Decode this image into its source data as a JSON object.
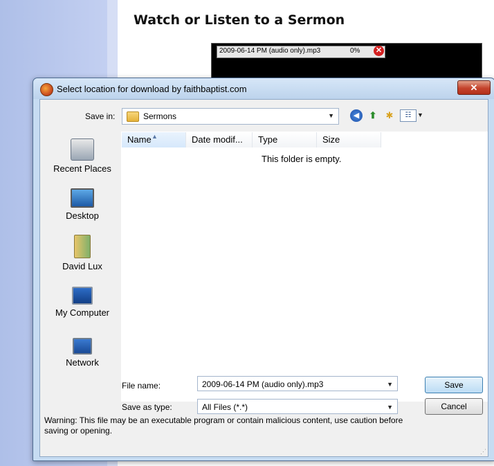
{
  "page": {
    "heading": "Watch or Listen to a Sermon"
  },
  "download_chip": {
    "filename": "2009-06-14 PM (audio only).mp3",
    "percent": "0%",
    "close_glyph": "✕"
  },
  "dialog": {
    "title": "Select location for download by faithbaptist.com",
    "close_glyph": "✕",
    "save_in_label": "Save in:",
    "save_in_value": "Sermons",
    "places": [
      {
        "label": "Recent Places",
        "icon": "recent-places-icon"
      },
      {
        "label": "Desktop",
        "icon": "desktop-icon"
      },
      {
        "label": "David Lux",
        "icon": "user-folder-icon"
      },
      {
        "label": "My Computer",
        "icon": "computer-icon"
      },
      {
        "label": "Network",
        "icon": "network-icon"
      }
    ],
    "columns": [
      "Name",
      "Date modif...",
      "Type",
      "Size"
    ],
    "empty_message": "This folder is empty.",
    "file_name_label": "File name:",
    "file_name_value": "2009-06-14 PM (audio only).mp3",
    "save_type_label": "Save as type:",
    "save_type_value": "All Files (*.*)",
    "save_button": "Save",
    "cancel_button": "Cancel",
    "warning": "Warning: This file may be an executable program or contain malicious content, use caution before saving or opening."
  },
  "icons": {
    "back": "back-icon",
    "up": "up-folder-icon",
    "new_folder": "new-folder-icon",
    "views": "views-menu-icon"
  }
}
